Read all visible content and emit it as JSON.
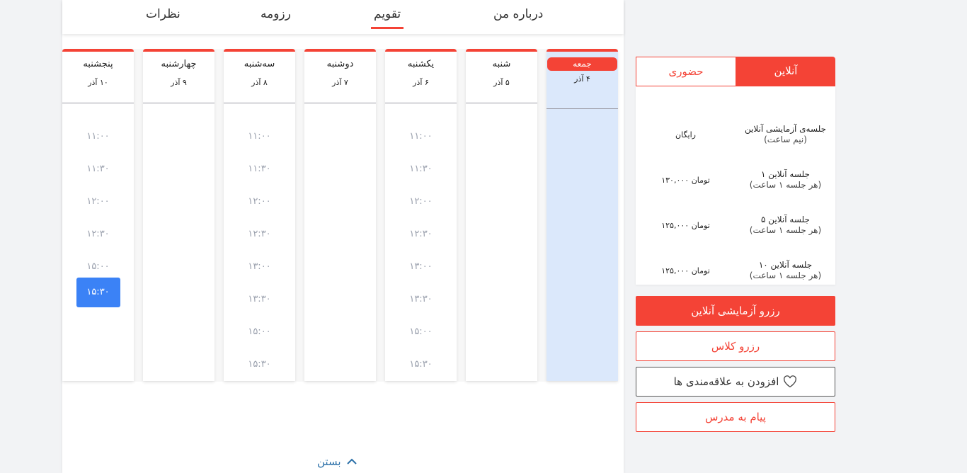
{
  "tabs": [
    "درباره من",
    "تقویم",
    "رزومه",
    "نظرات"
  ],
  "active_tab": 1,
  "days": [
    {
      "name": "جمعه",
      "date": "۴ آذر",
      "today": true,
      "slots": []
    },
    {
      "name": "شنبه",
      "date": "۵ آذر",
      "slots": []
    },
    {
      "name": "یکشنبه",
      "date": "۶ آذر",
      "slots": [
        "۱۱:۰۰",
        "۱۱:۳۰",
        "۱۲:۰۰",
        "۱۲:۳۰",
        "۱۳:۰۰",
        "۱۳:۳۰",
        "۱۵:۰۰",
        "۱۵:۳۰"
      ]
    },
    {
      "name": "دوشنبه",
      "date": "۷ آذر",
      "slots": []
    },
    {
      "name": "سه‌شنبه",
      "date": "۸ آذر",
      "slots": [
        "۱۱:۰۰",
        "۱۱:۳۰",
        "۱۲:۰۰",
        "۱۲:۳۰",
        "۱۳:۰۰",
        "۱۳:۳۰",
        "۱۵:۰۰",
        "۱۵:۳۰"
      ]
    },
    {
      "name": "چهارشنبه",
      "date": "۹ آذر",
      "slots": []
    },
    {
      "name": "پنجشنبه",
      "date": "۱۰ آذر",
      "slots": [
        "۱۱:۰۰",
        "۱۱:۳۰",
        "۱۲:۰۰",
        "۱۲:۳۰",
        "۱۵:۰۰",
        "۱۵:۳۰"
      ],
      "selected": "۱۵:۳۰"
    }
  ],
  "close_label": "بستن",
  "pricing": {
    "tab_online": "آنلاین",
    "tab_inperson": "حضوری",
    "rows": [
      {
        "name": "جلسه‌ی آزمایشی آنلاین",
        "sub": "(نیم ساعت)",
        "price": "رایگان"
      },
      {
        "name": "۱ جلسه آنلاین",
        "sub": "(هر جلسه ۱ ساعت)",
        "price": "۱۳۰,۰۰۰ تومان"
      },
      {
        "name": "۵ جلسه آنلاین",
        "sub": "(هر جلسه ۱ ساعت)",
        "price": "۱۲۵,۰۰۰ تومان"
      },
      {
        "name": "۱۰ جلسه آنلاین",
        "sub": "(هر جلسه ۱ ساعت)",
        "price": "۱۲۵,۰۰۰ تومان"
      }
    ]
  },
  "buttons": {
    "trial": "رزرو آزمایشی آنلاین",
    "book": "رزرو کلاس",
    "favorite": "افزودن به علاقه‌مندی ها",
    "message": "پیام به مدرس"
  }
}
